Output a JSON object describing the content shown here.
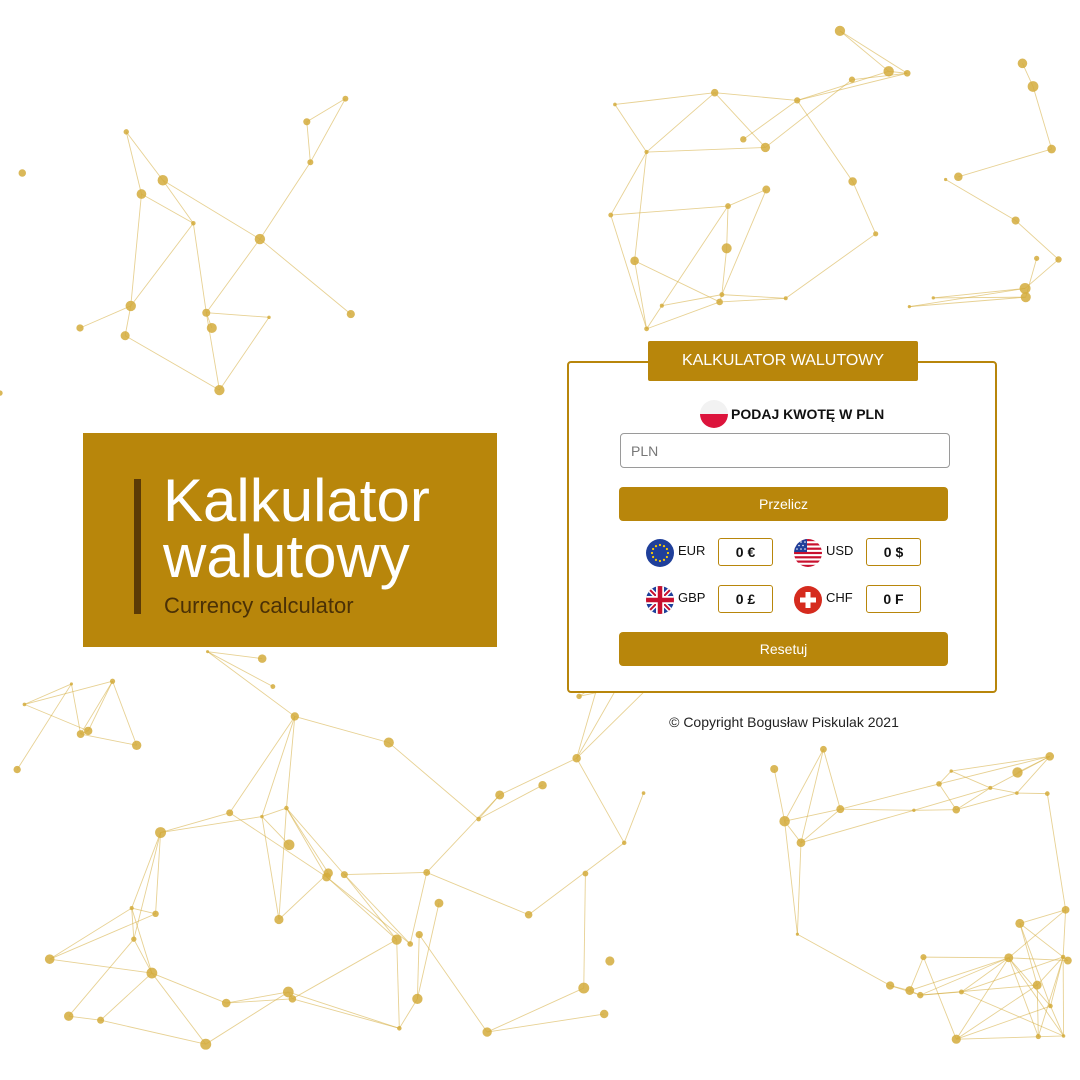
{
  "hero": {
    "title_line1": "Kalkulator",
    "title_line2": "walutowy",
    "subtitle": "Currency calculator"
  },
  "calculator": {
    "header": "KALKULATOR WALUTOWY",
    "amount_label": "PODAJ KWOTĘ W PLN",
    "amount_flag": "flag-poland-icon",
    "input": {
      "value": "",
      "placeholder": "PLN"
    },
    "calculate_label": "Przelicz",
    "reset_label": "Resetuj",
    "currencies": [
      {
        "code": "EUR",
        "value": "0 €",
        "flag": "flag-eu-icon"
      },
      {
        "code": "USD",
        "value": "0 $",
        "flag": "flag-usa-icon"
      },
      {
        "code": "GBP",
        "value": "0 £",
        "flag": "flag-uk-icon"
      },
      {
        "code": "CHF",
        "value": "0 F",
        "flag": "flag-switzerland-icon"
      }
    ]
  },
  "footer": {
    "copyright": "© Copyright Bogusław Piskulak 2021"
  },
  "colors": {
    "accent": "#b8860b",
    "accent_dark": "#5b3a06",
    "background": "#ffffff",
    "network_pattern": "#d4ac3c"
  }
}
